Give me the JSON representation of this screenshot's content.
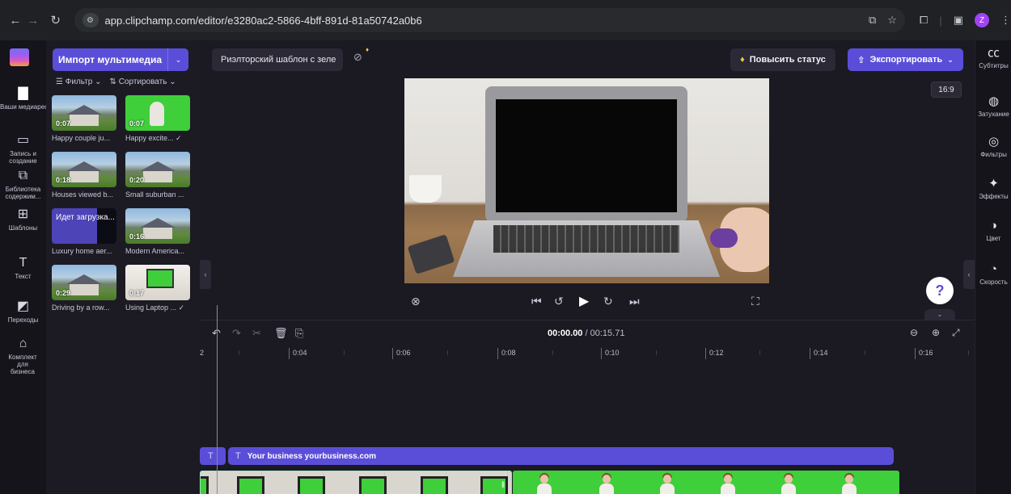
{
  "browser": {
    "url": "app.clipchamp.com/editor/e3280ac2-5866-4bff-891d-81a50742a0b6",
    "profile_initial": "Z"
  },
  "leftnav": {
    "items": [
      {
        "label": "Ваши медиарес...",
        "icon": "folder-icon"
      },
      {
        "label": "Запись и создание",
        "icon": "camera-icon"
      },
      {
        "label": "Библиотека содержим...",
        "icon": "library-icon"
      },
      {
        "label": "Шаблоны",
        "icon": "templates-icon"
      },
      {
        "label": "Текст",
        "icon": "text-icon"
      },
      {
        "label": "Переходы",
        "icon": "transitions-icon"
      },
      {
        "label": "Комплект для бизнеса",
        "icon": "brand-kit-icon"
      }
    ]
  },
  "media": {
    "import_label": "Импорт мультимедиа",
    "filter_label": "Фильтр",
    "sort_label": "Сортировать",
    "tiles": [
      {
        "caption": "Happy couple ju...",
        "duration": "0:07",
        "kind": "house"
      },
      {
        "caption": "Happy excite...",
        "duration": "0:07",
        "kind": "green"
      },
      {
        "caption": "Houses viewed b...",
        "duration": "0:18",
        "kind": "house"
      },
      {
        "caption": "Small suburban ...",
        "duration": "0:20",
        "kind": "house"
      },
      {
        "caption": "Luxury home aer...",
        "duration": "",
        "uploading": "Идет загрузка...",
        "kind": "purple"
      },
      {
        "caption": "Modern America...",
        "duration": "0:16",
        "kind": "house"
      },
      {
        "caption": "Driving by a row...",
        "duration": "0:29",
        "kind": "house"
      },
      {
        "caption": "Using Laptop ...",
        "duration": "0:17",
        "kind": "laptop"
      }
    ]
  },
  "topbar": {
    "project_name": "Риэлторский шаблон с зеле",
    "upgrade_label": "Повысить статус",
    "export_label": "Экспортировать"
  },
  "rightpanel": {
    "items": [
      {
        "label": "Субтитры",
        "icon": "captions-icon"
      },
      {
        "label": "Затухание",
        "icon": "fade-icon"
      },
      {
        "label": "Фильтры",
        "icon": "filters-icon"
      },
      {
        "label": "Эффекты",
        "icon": "effects-icon"
      },
      {
        "label": "Цвет",
        "icon": "color-icon"
      },
      {
        "label": "Скорость",
        "icon": "speed-icon"
      }
    ]
  },
  "preview": {
    "aspect_ratio": "16:9"
  },
  "timeline": {
    "current_time": "00:00.00",
    "total_time": "/ 00:15.71",
    "ruler_labels": [
      "2",
      "0:04",
      "0:06",
      "0:08",
      "0:10",
      "0:12",
      "0:14",
      "0:16"
    ],
    "text_clip_label": "Your business yourbusiness.com"
  },
  "help_label": "?"
}
